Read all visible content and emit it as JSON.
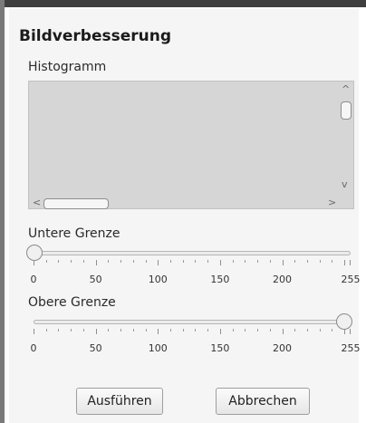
{
  "panel": {
    "title": "Bildverbesserung",
    "histogram_label": "Histogramm"
  },
  "scrollbars": {
    "up_icon": "chevron-up-icon",
    "down_icon": "chevron-down-icon",
    "left_icon": "chevron-left-icon",
    "right_icon": "chevron-right-icon"
  },
  "sliders": {
    "lower": {
      "label": "Untere Grenze",
      "value": 0,
      "min": 0,
      "max": 255,
      "tick_labels": [
        "0",
        "50",
        "100",
        "150",
        "200",
        "255"
      ]
    },
    "upper": {
      "label": "Obere Grenze",
      "value": 255,
      "min": 0,
      "max": 255,
      "tick_labels": [
        "0",
        "50",
        "100",
        "150",
        "200",
        "255"
      ]
    }
  },
  "buttons": {
    "run": "Ausführen",
    "cancel": "Abbrechen"
  }
}
